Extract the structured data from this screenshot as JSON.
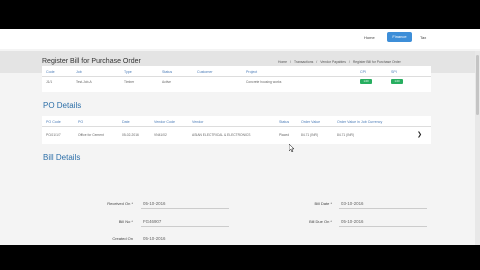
{
  "nav": {
    "home": "Home",
    "finance": "Finance",
    "tax": "Tax"
  },
  "page": {
    "title": "Register Bill for Purchase Order",
    "breadcrumbs": [
      "Home",
      "/",
      "Transactions",
      "/",
      "Vendor Payables",
      "/",
      "Register Bill for Purchase Order"
    ]
  },
  "job_table": {
    "headers": [
      "Code",
      "Job",
      "Type",
      "Status",
      "Customer",
      "Project",
      "CPI",
      "SPI"
    ],
    "row": [
      "J1/1",
      "Test-Job-A",
      "Timber",
      "Active",
      "",
      "Concrete housing works",
      "1.00",
      "1.00"
    ]
  },
  "po_details": {
    "title": "PO Details",
    "headers": [
      "PO Code",
      "PO",
      "Date",
      "Vendor Code",
      "Vendor",
      "Status",
      "Order Value",
      "Order Value in Job Currency"
    ],
    "row": [
      "PO/J1/1/7",
      "Office for Cement",
      "05-02-2016",
      "VN41/02",
      "ASIAN ELECTRICAL & ELECTRONICS",
      "Placed",
      "84.71 (INR)",
      "84.71 (INR)"
    ]
  },
  "bill_details": {
    "title": "Bill Details",
    "received_on_label": "Received On *",
    "received_on": "05-10-2016",
    "bill_no_label": "Bill No *",
    "bill_no": "FG46907",
    "created_on_label": "Created On",
    "created_on": "05-10-2016",
    "bill_date_label": "Bill Date *",
    "bill_date": "03-10-2016",
    "bill_due_on_label": "Bill Due On *",
    "bill_due_on": "05-10-2016"
  },
  "colors": {
    "accent": "#3d8ed8",
    "header_text": "#4a7bb7",
    "badge": "#27ae60"
  }
}
